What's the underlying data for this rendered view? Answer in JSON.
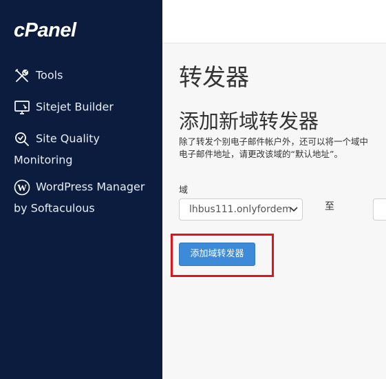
{
  "sidebar": {
    "logo": "cPanel",
    "items": [
      {
        "label": "Tools",
        "icon": "tools-icon"
      },
      {
        "label": "Sitejet Builder",
        "icon": "monitor-icon"
      },
      {
        "label": "Site Quality",
        "label_line2": "Monitoring",
        "icon": "magnifier-icon"
      },
      {
        "label": "WordPress Manager",
        "label_line2": "by Softaculous",
        "icon": "wordpress-icon"
      }
    ]
  },
  "main": {
    "page_title": "转发器",
    "section_title": "添加新域转发器",
    "description_line1": "除了转发个别电子邮件帐户外，还可以将一个域中",
    "description_line2": "电子邮件地址，请更改该域的“默认地址”。",
    "domain_label": "域",
    "domain_value": "lhbus111.onlyfordem",
    "to_label": "至",
    "add_button": "添加域转发器"
  },
  "colors": {
    "sidebar_bg": "#0b1c3f",
    "primary_button": "#3d8ad8",
    "highlight": "#e0121b"
  }
}
